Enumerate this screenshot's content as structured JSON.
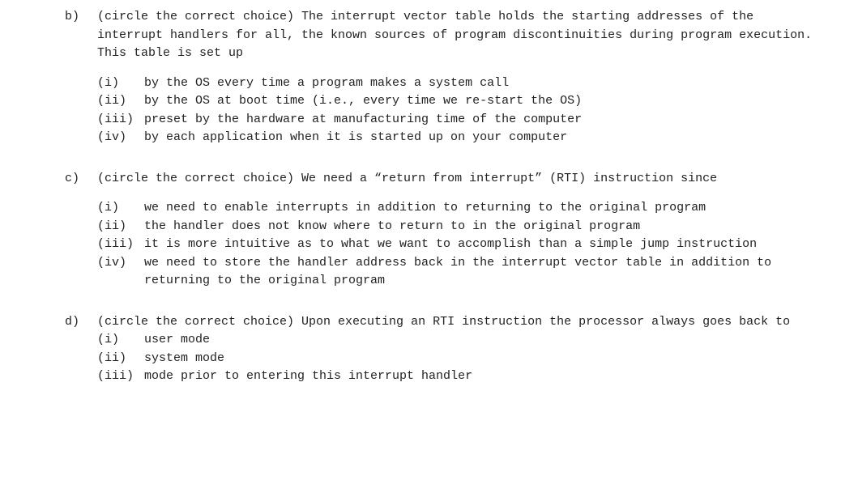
{
  "questions": [
    {
      "label": "b)",
      "prompt": "(circle the correct choice) The interrupt vector table holds the starting addresses of the interrupt handlers for all, the known sources of program discontinuities during program execution. This table is set up",
      "tight": false,
      "options": [
        {
          "label": "(i)",
          "text": "by the OS every time a program makes a system call"
        },
        {
          "label": "(ii)",
          "text": "by the OS at boot time (i.e., every time we re-start the OS)"
        },
        {
          "label": "(iii)",
          "text": "preset by the hardware at manufacturing time of the computer"
        },
        {
          "label": "(iv)",
          "text": "by each application when it is started up on your computer"
        }
      ]
    },
    {
      "label": "c)",
      "prompt": "(circle the correct choice) We need a “return from interrupt” (RTI) instruction since",
      "tight": false,
      "options": [
        {
          "label": "(i)",
          "text": "we need to enable interrupts in addition to returning to the original program"
        },
        {
          "label": "(ii)",
          "text": "the handler does not know where to return to in the original program"
        },
        {
          "label": "(iii)",
          "text": "it is more intuitive as to what we want to accomplish than a simple jump instruction"
        },
        {
          "label": "(iv)",
          "text": "we need to store the handler address back in the interrupt vector table in addition to returning to the original program"
        }
      ]
    },
    {
      "label": "d)",
      "prompt": "(circle the correct choice) Upon executing an RTI instruction the processor always goes back to",
      "tight": true,
      "options": [
        {
          "label": "(i)",
          "text": "user mode"
        },
        {
          "label": "(ii)",
          "text": "system mode"
        },
        {
          "label": "(iii)",
          "text": "mode prior to entering this interrupt handler"
        }
      ]
    }
  ]
}
